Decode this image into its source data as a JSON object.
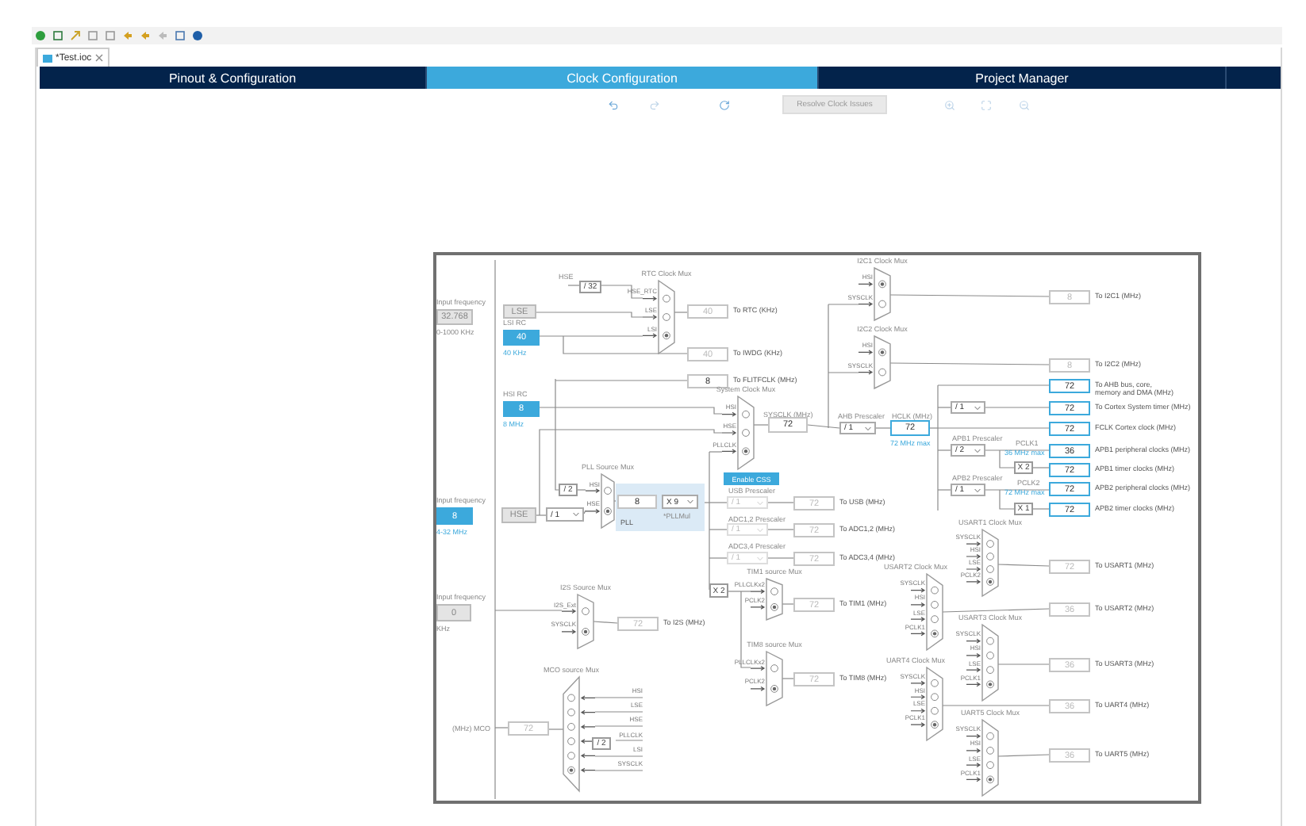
{
  "editor_tab": {
    "title": "*Test.ioc"
  },
  "tabs": [
    {
      "label": "Pinout & Configuration",
      "selected": false
    },
    {
      "label": "Clock Configuration",
      "selected": true
    },
    {
      "label": "Project Manager",
      "selected": false
    }
  ],
  "resolve_button": {
    "label": "Resolve Clock Issues",
    "enabled": false
  },
  "diagram": {
    "nodes": [
      {
        "kind": "source",
        "title": "Input frequency",
        "value": "32.768",
        "note": "0-1000 KHz",
        "active": false
      },
      {
        "kind": "source",
        "value": "LSE",
        "active": false
      },
      {
        "kind": "source",
        "title": "LSI RC",
        "value": "40",
        "note": "40 KHz",
        "active": true
      },
      {
        "kind": "caption",
        "text": "HSE",
        "accent": false
      },
      {
        "kind": "factor",
        "value": "/ 32"
      },
      {
        "kind": "mux",
        "title": "RTC Clock Mux",
        "inputs": [
          {
            "label": "HSE_RTC",
            "selected": false
          },
          {
            "label": "LSE",
            "selected": false
          },
          {
            "label": "LSI",
            "selected": true
          }
        ]
      },
      {
        "kind": "output",
        "value": "40",
        "label": "To RTC (KHz)",
        "enabled": false,
        "highlight": false
      },
      {
        "kind": "output",
        "value": "40",
        "label": "To IWDG (KHz)",
        "enabled": false,
        "highlight": false
      },
      {
        "kind": "output",
        "value": "8",
        "label": "To FLITFCLK (MHz)",
        "enabled": true,
        "highlight": false
      },
      {
        "kind": "source",
        "title": "HSI RC",
        "value": "8",
        "note": "8 MHz",
        "active": true
      },
      {
        "kind": "mux",
        "title": "System Clock Mux",
        "inputs": [
          {
            "label": "HSI",
            "selected": false
          },
          {
            "label": "HSE",
            "selected": false
          },
          {
            "label": "PLLCLK",
            "selected": true
          }
        ]
      },
      {
        "kind": "caption",
        "text": "SYSCLK (MHz)",
        "accent": false
      },
      {
        "kind": "output",
        "value": "72",
        "enabled": true,
        "highlight": false
      },
      {
        "kind": "button",
        "label": "Enable CSS"
      },
      {
        "kind": "source",
        "title": "Input frequency",
        "value": "8",
        "note": "4-32 MHz",
        "active": true
      },
      {
        "kind": "source",
        "value": "HSE",
        "active": false
      },
      {
        "kind": "dropdown",
        "value": "/ 1",
        "enabled": true
      },
      {
        "kind": "factor",
        "value": "/ 2"
      },
      {
        "kind": "mux",
        "title": "PLL Source Mux",
        "inputs": [
          {
            "label": "HSI",
            "selected": false
          },
          {
            "label": "HSE",
            "selected": true
          }
        ]
      },
      {
        "kind": "panel",
        "label": "PLL"
      },
      {
        "kind": "output",
        "value": "8",
        "enabled": true,
        "highlight": false
      },
      {
        "kind": "dropdown",
        "value": "X 9",
        "enabled": true
      },
      {
        "kind": "caption",
        "text": "*PLLMul",
        "accent": false
      },
      {
        "kind": "caption",
        "text": "USB Prescaler",
        "accent": false
      },
      {
        "kind": "dropdown",
        "value": "/ 1",
        "enabled": false
      },
      {
        "kind": "output",
        "value": "72",
        "label": "To USB (MHz)",
        "enabled": false,
        "highlight": false
      },
      {
        "kind": "caption",
        "text": "ADC1,2 Prescaler",
        "accent": false
      },
      {
        "kind": "dropdown",
        "value": "/ 1",
        "enabled": false
      },
      {
        "kind": "output",
        "value": "72",
        "label": "To ADC1,2 (MHz)",
        "enabled": false,
        "highlight": false
      },
      {
        "kind": "caption",
        "text": "ADC3,4 Prescaler",
        "accent": false
      },
      {
        "kind": "dropdown",
        "value": "/ 1",
        "enabled": false
      },
      {
        "kind": "output",
        "value": "72",
        "label": "To ADC3,4 (MHz)",
        "enabled": false,
        "highlight": false
      },
      {
        "kind": "factor",
        "value": "X 2"
      },
      {
        "kind": "mux",
        "title": "TIM1 source Mux",
        "inputs": [
          {
            "label": "PLLCLKx2",
            "selected": false
          },
          {
            "label": "PCLK2",
            "selected": true
          }
        ]
      },
      {
        "kind": "output",
        "value": "72",
        "label": "To TIM1 (MHz)",
        "enabled": false,
        "highlight": false
      },
      {
        "kind": "mux",
        "title": "TIM8 source Mux",
        "inputs": [
          {
            "label": "PLLCLKx2",
            "selected": false
          },
          {
            "label": "PCLK2",
            "selected": true
          }
        ]
      },
      {
        "kind": "output",
        "value": "72",
        "label": "To TIM8 (MHz)",
        "enabled": false,
        "highlight": false
      },
      {
        "kind": "source",
        "title": "Input frequency",
        "value": "0",
        "note": "KHz",
        "active": false
      },
      {
        "kind": "mux",
        "title": "I2S Source Mux",
        "inputs": [
          {
            "label": "I2S_Ext",
            "selected": false
          },
          {
            "label": "SYSCLK",
            "selected": true
          }
        ]
      },
      {
        "kind": "output",
        "value": "72",
        "label": "To I2S (MHz)",
        "enabled": false,
        "highlight": false
      },
      {
        "kind": "mux",
        "title": "MCO source Mux",
        "inputs": [
          {
            "label": "HSI",
            "selected": false
          },
          {
            "label": "LSE",
            "selected": false
          },
          {
            "label": "HSE",
            "selected": false
          },
          {
            "label": "PLLCLK",
            "selected": false
          },
          {
            "label": "LSI",
            "selected": false
          },
          {
            "label": "SYSCLK",
            "selected": true
          }
        ]
      },
      {
        "kind": "factor",
        "value": "/ 2"
      },
      {
        "kind": "output",
        "value": "72",
        "enabled": false,
        "highlight": false
      },
      {
        "kind": "caption",
        "text": "(MHz) MCO",
        "accent": false
      },
      {
        "kind": "mux",
        "title": "I2C1 Clock Mux",
        "inputs": [
          {
            "label": "HSI",
            "selected": true
          },
          {
            "label": "SYSCLK",
            "selected": false
          }
        ]
      },
      {
        "kind": "output",
        "value": "8",
        "label": "To I2C1 (MHz)",
        "enabled": false,
        "highlight": false
      },
      {
        "kind": "mux",
        "title": "I2C2 Clock Mux",
        "inputs": [
          {
            "label": "HSI",
            "selected": true
          },
          {
            "label": "SYSCLK",
            "selected": false
          }
        ]
      },
      {
        "kind": "output",
        "value": "8",
        "label": "To I2C2 (MHz)",
        "enabled": false,
        "highlight": false
      },
      {
        "kind": "caption",
        "text": "AHB Prescaler",
        "accent": false
      },
      {
        "kind": "dropdown",
        "value": "/ 1",
        "enabled": true
      },
      {
        "kind": "caption",
        "text": "HCLK (MHz)",
        "accent": false
      },
      {
        "kind": "output",
        "value": "72",
        "enabled": true,
        "highlight": true
      },
      {
        "kind": "caption",
        "text": "72 MHz max",
        "accent": true
      },
      {
        "kind": "output",
        "value": "72",
        "label": "To AHB bus, core, memory and DMA (MHz)",
        "enabled": true,
        "highlight": true
      },
      {
        "kind": "dropdown",
        "value": "/ 1",
        "enabled": true
      },
      {
        "kind": "output",
        "value": "72",
        "label": "To Cortex System timer (MHz)",
        "enabled": true,
        "highlight": true
      },
      {
        "kind": "output",
        "value": "72",
        "label": "FCLK Cortex clock (MHz)",
        "enabled": true,
        "highlight": true
      },
      {
        "kind": "caption",
        "text": "APB1 Prescaler",
        "accent": false
      },
      {
        "kind": "dropdown",
        "value": "/ 2",
        "enabled": true
      },
      {
        "kind": "caption",
        "text": "PCLK1",
        "accent": false
      },
      {
        "kind": "caption",
        "text": "36 MHz max",
        "accent": true
      },
      {
        "kind": "output",
        "value": "36",
        "label": "APB1 peripheral clocks (MHz)",
        "enabled": true,
        "highlight": true
      },
      {
        "kind": "factor",
        "value": "X 2"
      },
      {
        "kind": "output",
        "value": "72",
        "label": "APB1 timer clocks (MHz)",
        "enabled": true,
        "highlight": true
      },
      {
        "kind": "caption",
        "text": "APB2 Prescaler",
        "accent": false
      },
      {
        "kind": "dropdown",
        "value": "/ 1",
        "enabled": true
      },
      {
        "kind": "caption",
        "text": "PCLK2",
        "accent": false
      },
      {
        "kind": "caption",
        "text": "72 MHz max",
        "accent": true
      },
      {
        "kind": "output",
        "value": "72",
        "label": "APB2 peripheral clocks (MHz)",
        "enabled": true,
        "highlight": true
      },
      {
        "kind": "factor",
        "value": "X 1"
      },
      {
        "kind": "output",
        "value": "72",
        "label": "APB2 timer clocks (MHz)",
        "enabled": true,
        "highlight": true
      },
      {
        "kind": "mux",
        "title": "USART1 Clock Mux",
        "inputs": [
          {
            "label": "SYSCLK",
            "selected": false
          },
          {
            "label": "HSI",
            "selected": false
          },
          {
            "label": "LSE",
            "selected": false
          },
          {
            "label": "PCLK2",
            "selected": true
          }
        ]
      },
      {
        "kind": "mux",
        "title": "USART2 Clock Mux",
        "inputs": [
          {
            "label": "SYSCLK",
            "selected": false
          },
          {
            "label": "HSI",
            "selected": false
          },
          {
            "label": "LSE",
            "selected": false
          },
          {
            "label": "PCLK1",
            "selected": true
          }
        ]
      },
      {
        "kind": "output",
        "value": "72",
        "label": "To USART1 (MHz)",
        "enabled": false,
        "highlight": false
      },
      {
        "kind": "output",
        "value": "36",
        "label": "To USART2 (MHz)",
        "enabled": false,
        "highlight": false
      },
      {
        "kind": "mux",
        "title": "USART3 Clock Mux",
        "inputs": [
          {
            "label": "SYSCLK",
            "selected": false
          },
          {
            "label": "HSI",
            "selected": false
          },
          {
            "label": "LSE",
            "selected": false
          },
          {
            "label": "PCLK1",
            "selected": true
          }
        ]
      },
      {
        "kind": "mux",
        "title": "UART4 Clock Mux",
        "inputs": [
          {
            "label": "SYSCLK",
            "selected": false
          },
          {
            "label": "HSI",
            "selected": false
          },
          {
            "label": "LSE",
            "selected": false
          },
          {
            "label": "PCLK1",
            "selected": true
          }
        ]
      },
      {
        "kind": "output",
        "value": "36",
        "label": "To USART3 (MHz)",
        "enabled": false,
        "highlight": false
      },
      {
        "kind": "output",
        "value": "36",
        "label": "To UART4 (MHz)",
        "enabled": false,
        "highlight": false
      },
      {
        "kind": "mux",
        "title": "UART5 Clock Mux",
        "inputs": [
          {
            "label": "SYSCLK",
            "selected": false
          },
          {
            "label": "HSI",
            "selected": false
          },
          {
            "label": "LSE",
            "selected": false
          },
          {
            "label": "PCLK1",
            "selected": true
          }
        ]
      },
      {
        "kind": "output",
        "value": "36",
        "label": "To UART5 (MHz)",
        "enabled": false,
        "highlight": false
      }
    ]
  }
}
